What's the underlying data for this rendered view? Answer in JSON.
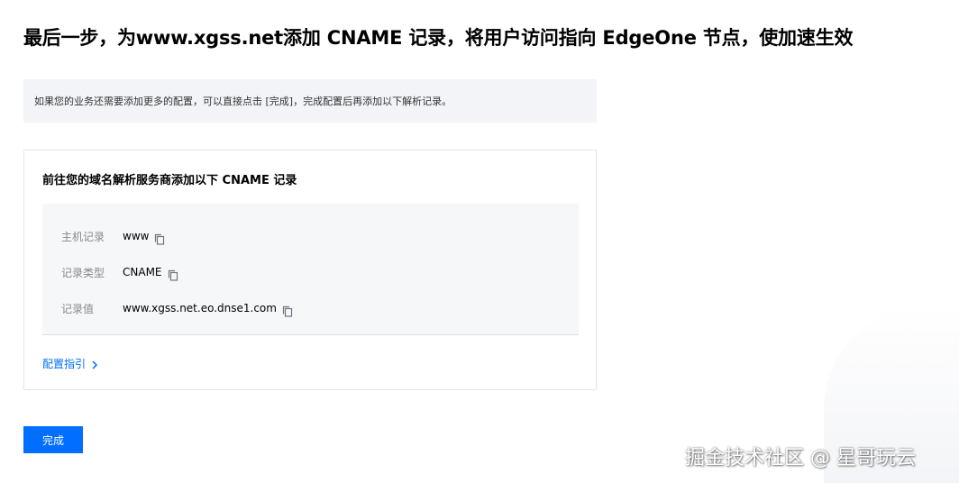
{
  "page": {
    "title": "最后一步，为www.xgss.net添加 CNAME 记录，将用户访问指向 EdgeOne 节点，使加速生效"
  },
  "tip": {
    "text": "如果您的业务还需要添加更多的配置，可以直接点击 [完成]，完成配置后再添加以下解析记录。"
  },
  "card": {
    "heading": "前往您的域名解析服务商添加以下 CNAME 记录",
    "records": [
      {
        "label": "主机记录",
        "value": "www"
      },
      {
        "label": "记录类型",
        "value": "CNAME"
      },
      {
        "label": "记录值",
        "value": "www.xgss.net.eo.dnse1.com"
      }
    ],
    "guide_link": "配置指引"
  },
  "actions": {
    "done_label": "完成"
  },
  "watermark": {
    "text": "掘金技术社区 @ 星哥玩云"
  },
  "colors": {
    "accent": "#006eff",
    "tip_background": "#f2f4f8",
    "panel_background": "#f6f7f9"
  },
  "icons": {
    "copy": "copy-icon",
    "chevron": "chevron-right-icon"
  }
}
